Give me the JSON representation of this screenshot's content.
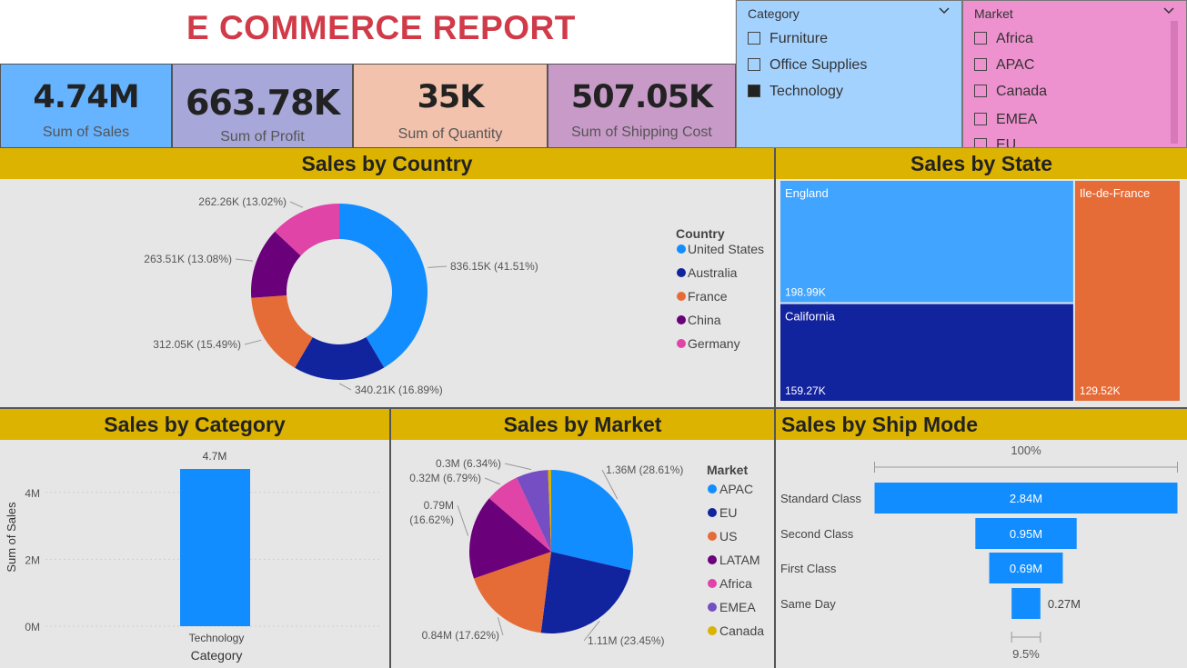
{
  "header": {
    "title": "E COMMERCE REPORT"
  },
  "kpis": [
    {
      "value": "4.74M",
      "label": "Sum of Sales",
      "color": "#66b3ff"
    },
    {
      "value": "663.78K",
      "label": "Sum of Profit",
      "color": "#a7a7d9"
    },
    {
      "value": "35K",
      "label": "Sum of Quantity",
      "color": "#f3c2ad"
    },
    {
      "value": "507.05K",
      "label": "Sum of Shipping Cost",
      "color": "#c79ac8"
    }
  ],
  "slicers": {
    "category": {
      "header": "Category",
      "color": "#a4d2ff",
      "items": [
        {
          "label": "Furniture",
          "checked": false
        },
        {
          "label": "Office Supplies",
          "checked": false
        },
        {
          "label": "Technology",
          "checked": true
        }
      ]
    },
    "market": {
      "header": "Market",
      "color": "#ee91cf",
      "items": [
        {
          "label": "Africa",
          "checked": false
        },
        {
          "label": "APAC",
          "checked": false
        },
        {
          "label": "Canada",
          "checked": false
        },
        {
          "label": "EMEA",
          "checked": false
        },
        {
          "label": "EU",
          "checked": false
        }
      ]
    }
  },
  "panels": {
    "country": "Sales by Country",
    "state": "Sales by State",
    "category": "Sales by Category",
    "market": "Sales by Market",
    "shipmode": "Sales by Ship Mode"
  },
  "chart_data": [
    {
      "type": "pie",
      "title": "Sales by Country",
      "donut": true,
      "legend_title": "Country",
      "legend_position": "right",
      "slices": [
        {
          "name": "United States",
          "value": 836.15,
          "label": "836.15K (41.51%)",
          "color": "#118dff"
        },
        {
          "name": "Australia",
          "value": 340.21,
          "label": "340.21K (16.89%)",
          "color": "#12239e"
        },
        {
          "name": "France",
          "value": 312.05,
          "label": "312.05K (15.49%)",
          "color": "#e66c37"
        },
        {
          "name": "China",
          "value": 263.51,
          "label": "263.51K (13.08%)",
          "color": "#6b007b"
        },
        {
          "name": "Germany",
          "value": 262.26,
          "label": "262.26K (13.02%)",
          "color": "#e044a7"
        }
      ]
    },
    {
      "type": "treemap",
      "title": "Sales by State",
      "items": [
        {
          "name": "England",
          "value": 198.99,
          "label": "198.99K",
          "color": "#41a4ff"
        },
        {
          "name": "California",
          "value": 159.27,
          "label": "159.27K",
          "color": "#12239e"
        },
        {
          "name": "Ile-de-France",
          "value": 129.52,
          "label": "129.52K",
          "color": "#e66c37"
        }
      ]
    },
    {
      "type": "bar",
      "title": "Sales by Category",
      "categories": [
        "Technology"
      ],
      "values": [
        4.7
      ],
      "data_labels": [
        "4.7M"
      ],
      "xlabel": "Category",
      "ylabel": "Sum of Sales",
      "ylim": [
        0,
        4.7
      ],
      "yticks": [
        {
          "value": 0,
          "label": "0M"
        },
        {
          "value": 2,
          "label": "2M"
        },
        {
          "value": 4,
          "label": "4M"
        }
      ],
      "color": "#118dff"
    },
    {
      "type": "pie",
      "title": "Sales by Market",
      "legend_title": "Market",
      "legend_position": "right",
      "slices": [
        {
          "name": "APAC",
          "value": 1.36,
          "label": "1.36M (28.61%)",
          "color": "#118dff"
        },
        {
          "name": "EU",
          "value": 1.11,
          "label": "1.11M (23.45%)",
          "color": "#12239e"
        },
        {
          "name": "US",
          "value": 0.84,
          "label": "0.84M (17.62%)",
          "color": "#e66c37"
        },
        {
          "name": "LATAM",
          "value": 0.79,
          "label": "0.79M (16.62%)",
          "color": "#6b007b"
        },
        {
          "name": "Africa",
          "value": 0.32,
          "label": "0.32M (6.79%)",
          "color": "#e044a7"
        },
        {
          "name": "EMEA",
          "value": 0.3,
          "label": "0.3M (6.34%)",
          "color": "#744ec2"
        },
        {
          "name": "Canada",
          "value": 0.03,
          "label": "",
          "color": "#d9b300"
        }
      ]
    },
    {
      "type": "funnel",
      "title": "Sales by Ship Mode",
      "top_label": "100%",
      "bottom_label": "9.5%",
      "stages": [
        {
          "name": "Standard Class",
          "value": 2.84,
          "label": "2.84M"
        },
        {
          "name": "Second Class",
          "value": 0.95,
          "label": "0.95M"
        },
        {
          "name": "First Class",
          "value": 0.69,
          "label": "0.69M"
        },
        {
          "name": "Same Day",
          "value": 0.27,
          "label": "0.27M"
        }
      ],
      "color": "#118dff"
    }
  ]
}
